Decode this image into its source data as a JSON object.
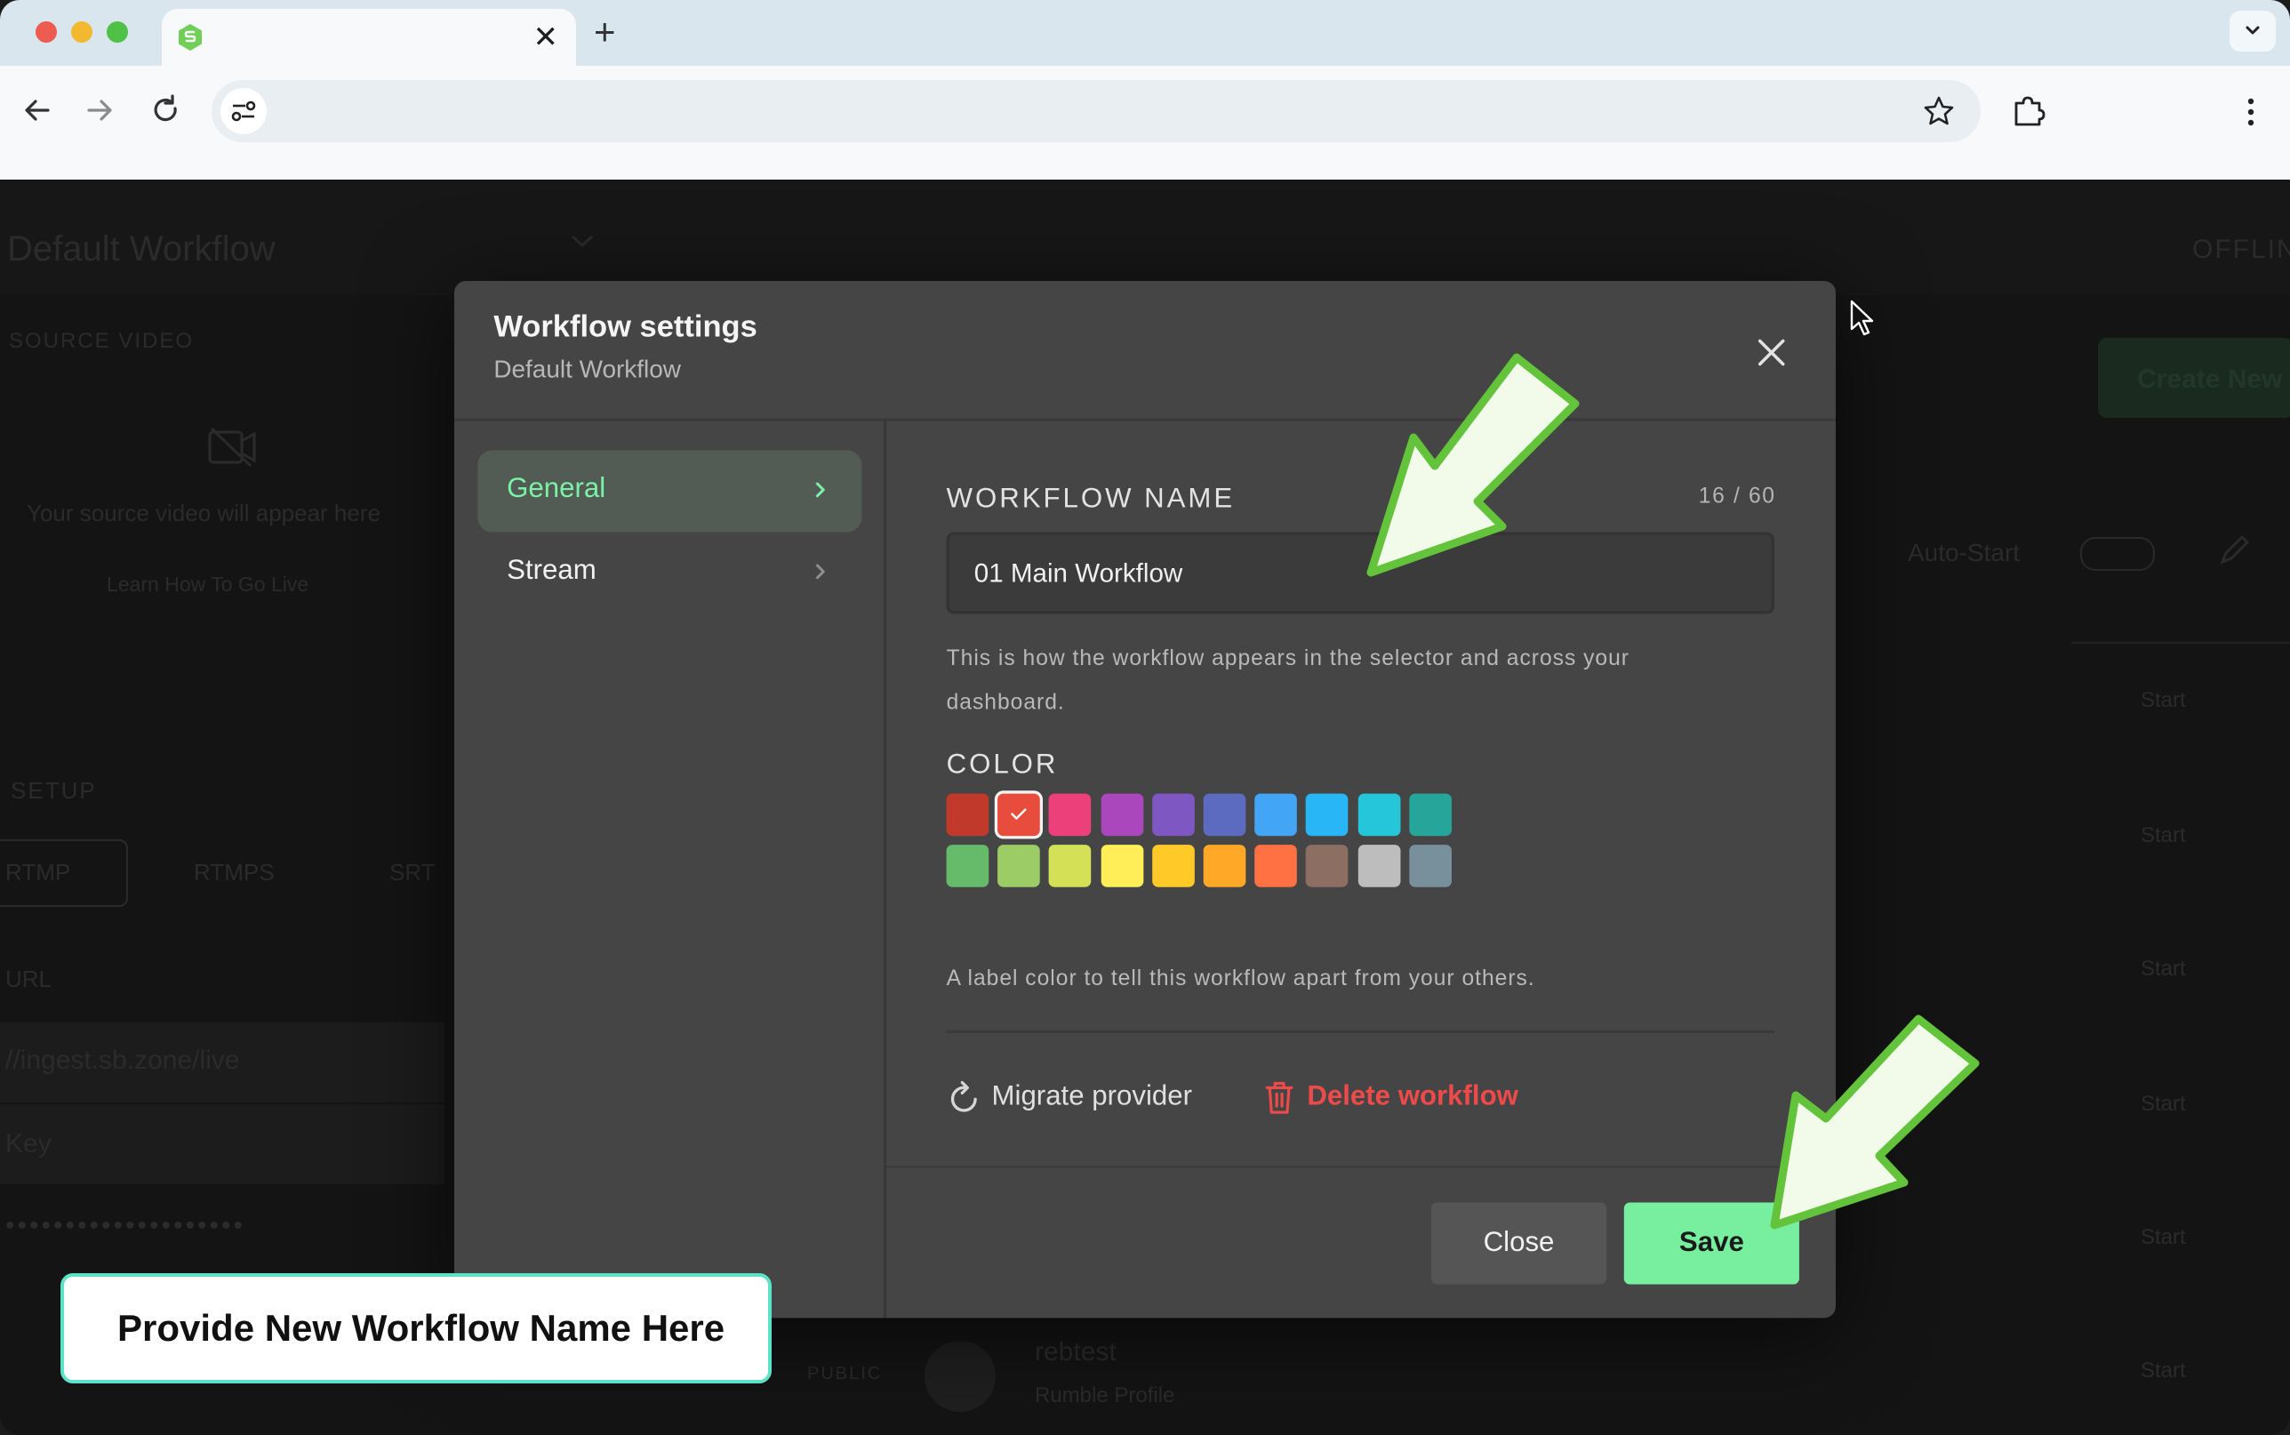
{
  "browser": {
    "tab_title": "",
    "new_tab_label": "+",
    "close_tab_label": "✕"
  },
  "background": {
    "workflow_title": "Default Workflow",
    "source_label": "SOURCE VIDEO",
    "source_placeholder": "Your source video will appear here",
    "learn_link": "Learn How To Go Live",
    "setup_label": "SETUP",
    "protocol_tabs": [
      "RTMP",
      "RTMPS",
      "SRT"
    ],
    "url_label": "URL",
    "url_value": "//ingest.sb.zone/live",
    "key_label": "Key",
    "key_value": "••••••••••••••••••••",
    "status": "OFFLINE",
    "create_button": "Create New",
    "auto_start": "Auto-Start",
    "start_label": "Start",
    "visibility": "PUBLIC",
    "destination_name": "rebtest",
    "destination_sub": "Rumble Profile"
  },
  "modal": {
    "title": "Workflow settings",
    "subtitle": "Default Workflow",
    "nav": [
      {
        "label": "General",
        "active": true
      },
      {
        "label": "Stream",
        "active": false
      }
    ],
    "name_label": "WORKFLOW NAME",
    "name_counter": "16 / 60",
    "name_value": "01 Main Workflow",
    "name_help": [
      "This is how the workflow appears in the selector and across your",
      "dashboard."
    ],
    "color_label": "COLOR",
    "colors_row1": [
      "#c0392b",
      "#e74c3c",
      "#ec407a",
      "#ab47bc",
      "#7e57c2",
      "#5c6bc0",
      "#42a5f5",
      "#29b6f6",
      "#26c6da",
      "#26a69a"
    ],
    "colors_row2": [
      "#66bb6a",
      "#9ccc65",
      "#d4e157",
      "#ffee58",
      "#ffca28",
      "#ffa726",
      "#ff7043",
      "#8d6e63",
      "#bdbdbd",
      "#78909c"
    ],
    "selected_color_index": 1,
    "color_help": "A label color to tell this workflow apart from your others.",
    "migrate_label": "Migrate provider",
    "delete_label": "Delete workflow",
    "close_button": "Close",
    "save_button": "Save"
  },
  "annotation": {
    "callout_text": "Provide New Workflow Name Here"
  }
}
